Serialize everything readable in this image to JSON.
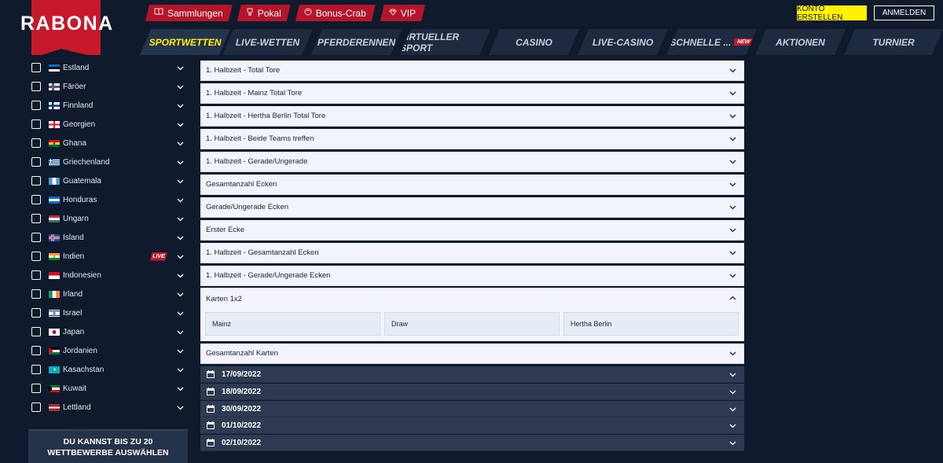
{
  "brand": {
    "logo_text": "RABONA"
  },
  "top_links": [
    {
      "label": "Sammlungen",
      "icon": "book-icon"
    },
    {
      "label": "Pokal",
      "icon": "trophy-icon"
    },
    {
      "label": "Bonus-Crab",
      "icon": "crab-icon"
    },
    {
      "label": "VIP",
      "icon": "diamond-icon"
    }
  ],
  "auth": {
    "register_label": "KONTO ERSTELLEN",
    "login_label": "ANMELDEN"
  },
  "nav": [
    {
      "label": "SPORTWETTEN",
      "active": true
    },
    {
      "label": "LIVE-WETTEN"
    },
    {
      "label": "PFERDERENNEN"
    },
    {
      "label": "VIRTUELLER SPORT"
    },
    {
      "label": "CASINO"
    },
    {
      "label": "LIVE-CASINO"
    },
    {
      "label": "SCHNELLE ...",
      "badge": "NEW"
    },
    {
      "label": "AKTIONEN"
    },
    {
      "label": "TURNIER"
    }
  ],
  "countries": [
    {
      "name": "Estland"
    },
    {
      "name": "Färöer"
    },
    {
      "name": "Finnland"
    },
    {
      "name": "Georgien"
    },
    {
      "name": "Ghana"
    },
    {
      "name": "Griechenland"
    },
    {
      "name": "Guatemala"
    },
    {
      "name": "Honduras"
    },
    {
      "name": "Ungarn"
    },
    {
      "name": "Island"
    },
    {
      "name": "Indien",
      "badge": "LIVE"
    },
    {
      "name": "Indonesien"
    },
    {
      "name": "Irland"
    },
    {
      "name": "Israel"
    },
    {
      "name": "Japan"
    },
    {
      "name": "Jordanien"
    },
    {
      "name": "Kasachstan"
    },
    {
      "name": "Kuwait"
    },
    {
      "name": "Lettland"
    }
  ],
  "sidebar_footer": "DU KANNST BIS ZU 20 WETTBEWERBE AUSWÄHLEN",
  "markets": [
    "1. Halbzeit - Total Tore",
    "1. Halbzeit - Mainz Total Tore",
    "1. Halbzeit - Hertha Berlin Total Tore",
    "1. Halbzeit - Beide Teams treffen",
    "1. Halbzeit - Gerade/Ungerade",
    "Gesamtanzahl Ecken",
    "Gerade/Ungerade Ecken",
    "Erster Ecke",
    "1. Halbzeit - Gesamtanzahl Ecken",
    "1. Halbzeit - Gerade/Ungerade Ecken"
  ],
  "expanded_market": {
    "title": "Karten 1x2",
    "options": [
      "Mainz",
      "Draw",
      "Hertha Berlin"
    ]
  },
  "after_market": "Gesamtanzahl Karten",
  "dates": [
    "17/09/2022",
    "18/09/2022",
    "30/09/2022",
    "01/10/2022",
    "02/10/2022"
  ],
  "colors": {
    "accent_red": "#c61a2c",
    "accent_yellow": "#fff200",
    "background": "#0f1a2c"
  }
}
